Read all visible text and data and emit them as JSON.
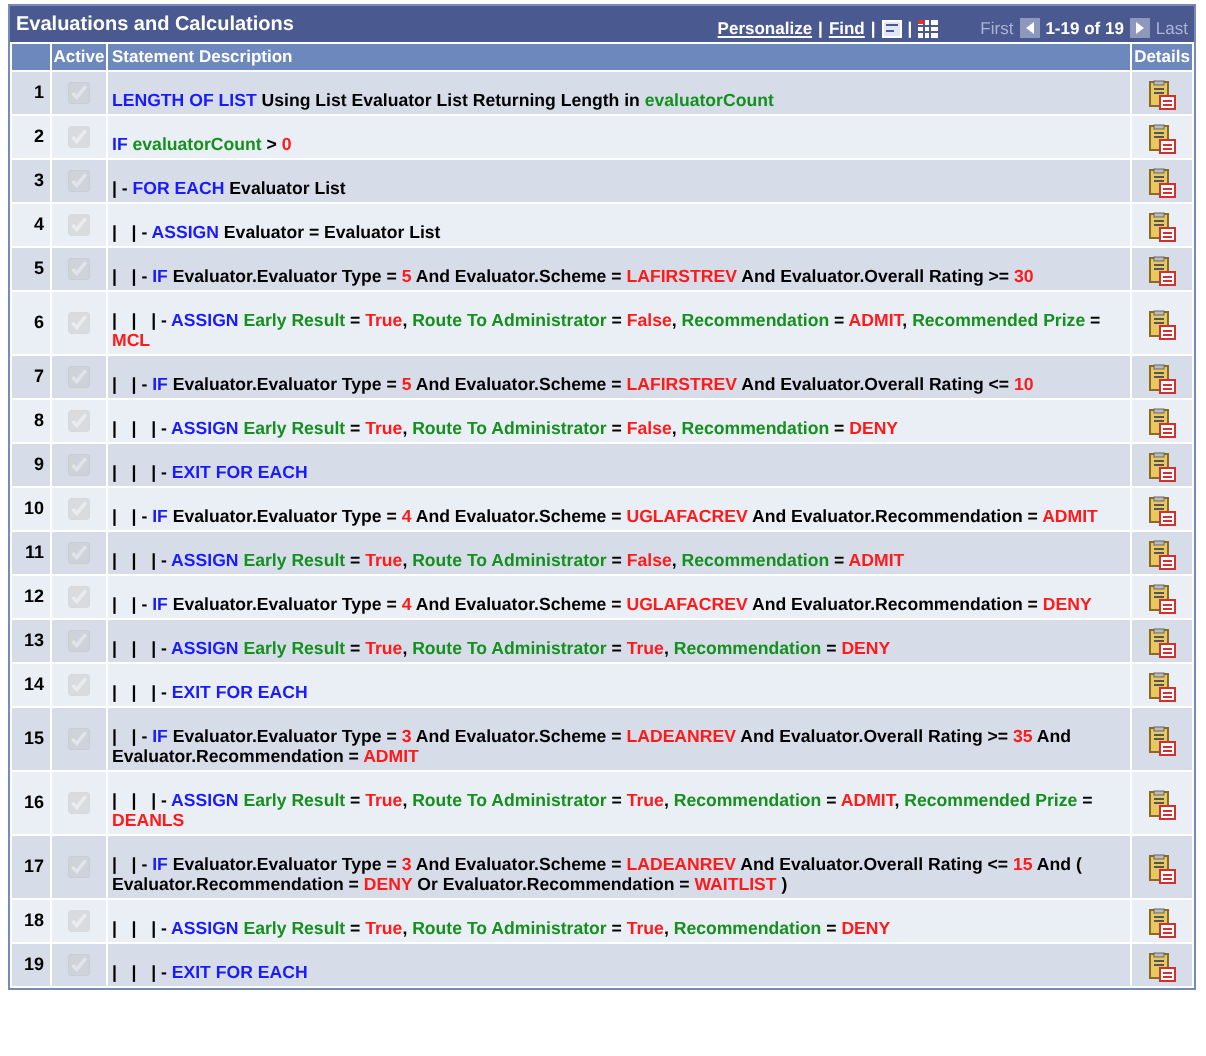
{
  "grid": {
    "title": "Evaluations and Calculations",
    "toolbar": {
      "personalize": "Personalize",
      "separator_1": "|",
      "find": "Find",
      "separator_2": "|",
      "first": "First",
      "range": "1-19 of 19",
      "last": "Last"
    },
    "columns": [
      "Active",
      "Statement Description",
      "Details"
    ],
    "rows": [
      {
        "number": "1",
        "active": true,
        "statement": [
          {
            "kind": "keyword",
            "text": "LENGTH OF LIST"
          },
          {
            "kind": "text",
            "text": " Using List Evaluator List Returning Length in "
          },
          {
            "kind": "field",
            "text": "evaluatorCount"
          }
        ]
      },
      {
        "number": "2",
        "active": true,
        "statement": [
          {
            "kind": "keyword",
            "text": "IF"
          },
          {
            "kind": "field",
            "text": " evaluatorCount"
          },
          {
            "kind": "text",
            "text": " > "
          },
          {
            "kind": "value",
            "text": "0"
          }
        ]
      },
      {
        "number": "3",
        "active": true,
        "statement": [
          {
            "kind": "text",
            "text": "| - "
          },
          {
            "kind": "keyword",
            "text": "FOR EACH"
          },
          {
            "kind": "text",
            "text": " Evaluator List"
          }
        ]
      },
      {
        "number": "4",
        "active": true,
        "statement": [
          {
            "kind": "text",
            "text": "|   | - "
          },
          {
            "kind": "keyword",
            "text": "ASSIGN"
          },
          {
            "kind": "text",
            "text": " Evaluator = Evaluator List"
          }
        ]
      },
      {
        "number": "5",
        "active": true,
        "statement": [
          {
            "kind": "text",
            "text": "|   | - "
          },
          {
            "kind": "keyword",
            "text": "IF"
          },
          {
            "kind": "text",
            "text": " Evaluator.Evaluator Type = "
          },
          {
            "kind": "value",
            "text": "5"
          },
          {
            "kind": "text",
            "text": " And Evaluator.Scheme = "
          },
          {
            "kind": "value",
            "text": "LAFIRSTREV"
          },
          {
            "kind": "text",
            "text": " And Evaluator.Overall Rating >= "
          },
          {
            "kind": "value",
            "text": "30"
          }
        ]
      },
      {
        "number": "6",
        "active": true,
        "statement": [
          {
            "kind": "text",
            "text": "|   |   | - "
          },
          {
            "kind": "keyword",
            "text": "ASSIGN"
          },
          {
            "kind": "field",
            "text": " Early Result"
          },
          {
            "kind": "text",
            "text": " = "
          },
          {
            "kind": "value",
            "text": "True"
          },
          {
            "kind": "text",
            "text": ", "
          },
          {
            "kind": "field",
            "text": "Route To Administrator"
          },
          {
            "kind": "text",
            "text": " = "
          },
          {
            "kind": "value",
            "text": "False"
          },
          {
            "kind": "text",
            "text": ", "
          },
          {
            "kind": "field",
            "text": "Recommendation"
          },
          {
            "kind": "text",
            "text": " = "
          },
          {
            "kind": "value",
            "text": "ADMIT"
          },
          {
            "kind": "text",
            "text": ", "
          },
          {
            "kind": "field",
            "text": "Recommended Prize"
          },
          {
            "kind": "text",
            "text": " = "
          },
          {
            "kind": "value",
            "text": "MCL"
          }
        ]
      },
      {
        "number": "7",
        "active": true,
        "statement": [
          {
            "kind": "text",
            "text": "|   | - "
          },
          {
            "kind": "keyword",
            "text": "IF"
          },
          {
            "kind": "text",
            "text": " Evaluator.Evaluator Type = "
          },
          {
            "kind": "value",
            "text": "5"
          },
          {
            "kind": "text",
            "text": " And Evaluator.Scheme = "
          },
          {
            "kind": "value",
            "text": "LAFIRSTREV"
          },
          {
            "kind": "text",
            "text": " And Evaluator.Overall Rating <= "
          },
          {
            "kind": "value",
            "text": "10"
          }
        ]
      },
      {
        "number": "8",
        "active": true,
        "statement": [
          {
            "kind": "text",
            "text": "|   |   | - "
          },
          {
            "kind": "keyword",
            "text": "ASSIGN"
          },
          {
            "kind": "field",
            "text": " Early Result"
          },
          {
            "kind": "text",
            "text": " = "
          },
          {
            "kind": "value",
            "text": "True"
          },
          {
            "kind": "text",
            "text": ", "
          },
          {
            "kind": "field",
            "text": "Route To Administrator"
          },
          {
            "kind": "text",
            "text": " = "
          },
          {
            "kind": "value",
            "text": "False"
          },
          {
            "kind": "text",
            "text": ", "
          },
          {
            "kind": "field",
            "text": "Recommendation"
          },
          {
            "kind": "text",
            "text": " = "
          },
          {
            "kind": "value",
            "text": "DENY"
          }
        ]
      },
      {
        "number": "9",
        "active": true,
        "statement": [
          {
            "kind": "text",
            "text": "|   |   | - "
          },
          {
            "kind": "keyword",
            "text": "EXIT FOR EACH"
          }
        ]
      },
      {
        "number": "10",
        "active": true,
        "statement": [
          {
            "kind": "text",
            "text": "|   | - "
          },
          {
            "kind": "keyword",
            "text": "IF"
          },
          {
            "kind": "text",
            "text": " Evaluator.Evaluator Type = "
          },
          {
            "kind": "value",
            "text": "4"
          },
          {
            "kind": "text",
            "text": " And Evaluator.Scheme = "
          },
          {
            "kind": "value",
            "text": "UGLAFACREV"
          },
          {
            "kind": "text",
            "text": " And Evaluator.Recommendation = "
          },
          {
            "kind": "value",
            "text": "ADMIT"
          }
        ]
      },
      {
        "number": "11",
        "active": true,
        "statement": [
          {
            "kind": "text",
            "text": "|   |   | - "
          },
          {
            "kind": "keyword",
            "text": "ASSIGN"
          },
          {
            "kind": "field",
            "text": " Early Result"
          },
          {
            "kind": "text",
            "text": " = "
          },
          {
            "kind": "value",
            "text": "True"
          },
          {
            "kind": "text",
            "text": ", "
          },
          {
            "kind": "field",
            "text": "Route To Administrator"
          },
          {
            "kind": "text",
            "text": " = "
          },
          {
            "kind": "value",
            "text": "False"
          },
          {
            "kind": "text",
            "text": ", "
          },
          {
            "kind": "field",
            "text": "Recommendation"
          },
          {
            "kind": "text",
            "text": " = "
          },
          {
            "kind": "value",
            "text": "ADMIT"
          }
        ]
      },
      {
        "number": "12",
        "active": true,
        "statement": [
          {
            "kind": "text",
            "text": "|   | - "
          },
          {
            "kind": "keyword",
            "text": "IF"
          },
          {
            "kind": "text",
            "text": " Evaluator.Evaluator Type = "
          },
          {
            "kind": "value",
            "text": "4"
          },
          {
            "kind": "text",
            "text": " And Evaluator.Scheme = "
          },
          {
            "kind": "value",
            "text": "UGLAFACREV"
          },
          {
            "kind": "text",
            "text": " And Evaluator.Recommendation = "
          },
          {
            "kind": "value",
            "text": "DENY"
          }
        ]
      },
      {
        "number": "13",
        "active": true,
        "statement": [
          {
            "kind": "text",
            "text": "|   |   | - "
          },
          {
            "kind": "keyword",
            "text": "ASSIGN"
          },
          {
            "kind": "field",
            "text": " Early Result"
          },
          {
            "kind": "text",
            "text": " = "
          },
          {
            "kind": "value",
            "text": "True"
          },
          {
            "kind": "text",
            "text": ", "
          },
          {
            "kind": "field",
            "text": "Route To Administrator"
          },
          {
            "kind": "text",
            "text": " = "
          },
          {
            "kind": "value",
            "text": "True"
          },
          {
            "kind": "text",
            "text": ", "
          },
          {
            "kind": "field",
            "text": "Recommendation"
          },
          {
            "kind": "text",
            "text": " = "
          },
          {
            "kind": "value",
            "text": "DENY"
          }
        ]
      },
      {
        "number": "14",
        "active": true,
        "statement": [
          {
            "kind": "text",
            "text": "|   |   | - "
          },
          {
            "kind": "keyword",
            "text": "EXIT FOR EACH"
          }
        ]
      },
      {
        "number": "15",
        "active": true,
        "statement": [
          {
            "kind": "text",
            "text": "|   | - "
          },
          {
            "kind": "keyword",
            "text": "IF"
          },
          {
            "kind": "text",
            "text": " Evaluator.Evaluator Type = "
          },
          {
            "kind": "value",
            "text": "3"
          },
          {
            "kind": "text",
            "text": " And Evaluator.Scheme = "
          },
          {
            "kind": "value",
            "text": "LADEANREV"
          },
          {
            "kind": "text",
            "text": " And Evaluator.Overall Rating >= "
          },
          {
            "kind": "value",
            "text": "35"
          },
          {
            "kind": "text",
            "text": " And Evaluator.Recommendation = "
          },
          {
            "kind": "value",
            "text": "ADMIT"
          }
        ]
      },
      {
        "number": "16",
        "active": true,
        "statement": [
          {
            "kind": "text",
            "text": "|   |   | - "
          },
          {
            "kind": "keyword",
            "text": "ASSIGN"
          },
          {
            "kind": "field",
            "text": " Early Result"
          },
          {
            "kind": "text",
            "text": " = "
          },
          {
            "kind": "value",
            "text": "True"
          },
          {
            "kind": "text",
            "text": ", "
          },
          {
            "kind": "field",
            "text": "Route To Administrator"
          },
          {
            "kind": "text",
            "text": " = "
          },
          {
            "kind": "value",
            "text": "True"
          },
          {
            "kind": "text",
            "text": ", "
          },
          {
            "kind": "field",
            "text": "Recommendation"
          },
          {
            "kind": "text",
            "text": " = "
          },
          {
            "kind": "value",
            "text": "ADMIT"
          },
          {
            "kind": "text",
            "text": ", "
          },
          {
            "kind": "field",
            "text": "Recommended Prize"
          },
          {
            "kind": "text",
            "text": " = "
          },
          {
            "kind": "value",
            "text": "DEANLS"
          }
        ]
      },
      {
        "number": "17",
        "active": true,
        "statement": [
          {
            "kind": "text",
            "text": "|   | - "
          },
          {
            "kind": "keyword",
            "text": "IF"
          },
          {
            "kind": "text",
            "text": " Evaluator.Evaluator Type = "
          },
          {
            "kind": "value",
            "text": "3"
          },
          {
            "kind": "text",
            "text": " And Evaluator.Scheme = "
          },
          {
            "kind": "value",
            "text": "LADEANREV"
          },
          {
            "kind": "text",
            "text": " And Evaluator.Overall Rating <= "
          },
          {
            "kind": "value",
            "text": "15"
          },
          {
            "kind": "text",
            "text": " And ( Evaluator.Recommendation = "
          },
          {
            "kind": "value",
            "text": "DENY"
          },
          {
            "kind": "text",
            "text": " Or Evaluator.Recommendation = "
          },
          {
            "kind": "value",
            "text": "WAITLIST"
          },
          {
            "kind": "text",
            "text": " )"
          }
        ]
      },
      {
        "number": "18",
        "active": true,
        "statement": [
          {
            "kind": "text",
            "text": "|   |   | - "
          },
          {
            "kind": "keyword",
            "text": "ASSIGN"
          },
          {
            "kind": "field",
            "text": " Early Result"
          },
          {
            "kind": "text",
            "text": " = "
          },
          {
            "kind": "value",
            "text": "True"
          },
          {
            "kind": "text",
            "text": ", "
          },
          {
            "kind": "field",
            "text": "Route To Administrator"
          },
          {
            "kind": "text",
            "text": " = "
          },
          {
            "kind": "value",
            "text": "True"
          },
          {
            "kind": "text",
            "text": ", "
          },
          {
            "kind": "field",
            "text": "Recommendation"
          },
          {
            "kind": "text",
            "text": " = "
          },
          {
            "kind": "value",
            "text": "DENY"
          }
        ]
      },
      {
        "number": "19",
        "active": true,
        "statement": [
          {
            "kind": "text",
            "text": "|   |   | - "
          },
          {
            "kind": "keyword",
            "text": "EXIT FOR EACH"
          }
        ]
      }
    ]
  }
}
